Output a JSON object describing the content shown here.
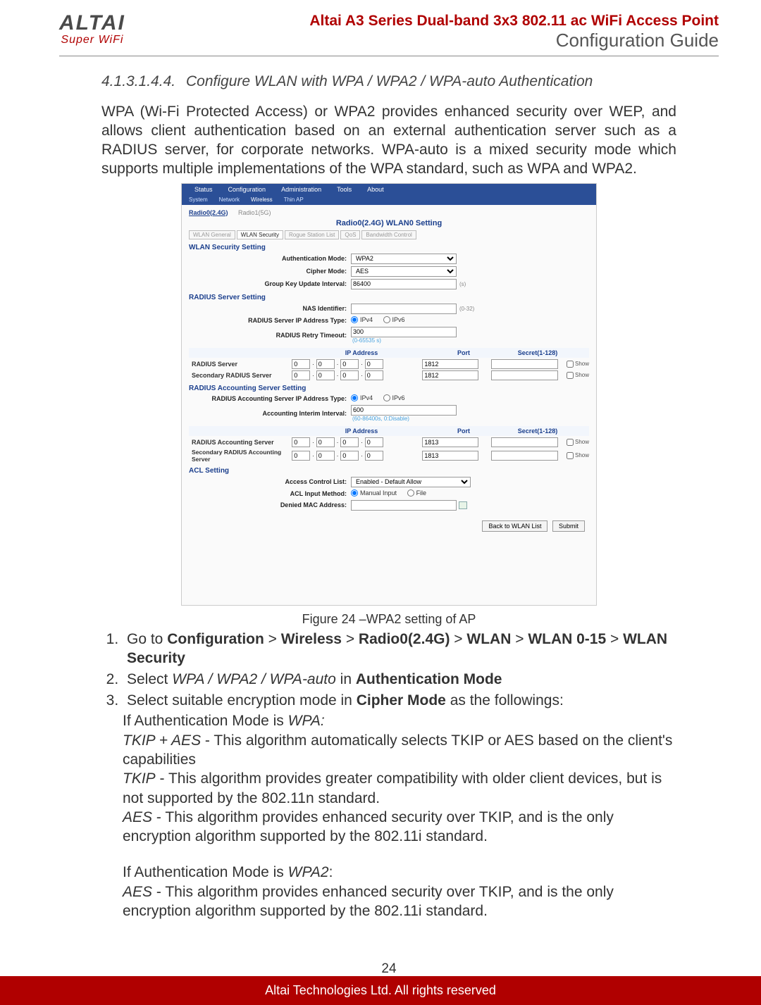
{
  "header": {
    "logo_top": "ALTAI",
    "logo_sub": "Super WiFi",
    "title1": "Altai A3 Series Dual-band 3x3 802.11 ac WiFi Access Point",
    "title2": "Configuration Guide"
  },
  "section": {
    "number": "4.1.3.1.4.4.",
    "title": "Configure WLAN with WPA / WPA2 / WPA-auto Authentication"
  },
  "intro": "WPA (Wi-Fi Protected Access) or WPA2 provides enhanced security over WEP, and allows client authentication based on an external authentication server such as a RADIUS server, for corporate networks. WPA-auto is a mixed security mode which supports multiple implementations of the WPA standard, such as WPA and WPA2.",
  "fig": {
    "topbar": [
      "Status",
      "Configuration",
      "Administration",
      "Tools",
      "About"
    ],
    "subbar": [
      "System",
      "Network",
      "Wireless",
      "Thin AP"
    ],
    "subbar_active": "Wireless",
    "radio_a": "Radio0(2.4G)",
    "radio_b": "Radio1(5G)",
    "panel_title": "Radio0(2.4G) WLAN0 Setting",
    "tabs": [
      "WLAN General",
      "WLAN Security",
      "Rogue Station List",
      "QoS",
      "Bandwidth Control"
    ],
    "tabs_active": "WLAN Security",
    "sec_wlan": "WLAN Security Setting",
    "lbl_auth": "Authentication Mode:",
    "val_auth": "WPA2",
    "lbl_cipher": "Cipher Mode:",
    "val_cipher": "AES",
    "lbl_gkui": "Group Key Update Interval:",
    "val_gkui": "86400",
    "gkui_hint": "(s)",
    "sec_radius": "RADIUS Server Setting",
    "lbl_nas": "NAS Identifier:",
    "nas_hint": "(0-32)",
    "lbl_rsat": "RADIUS Server IP Address Type:",
    "ipv4": "IPv4",
    "ipv6": "IPv6",
    "lbl_retry": "RADIUS Retry Timeout:",
    "val_retry": "300",
    "retry_hint": "(0-65535 s)",
    "th_ip": "IP Address",
    "th_port": "Port",
    "th_secret": "Secret(1-128)",
    "row_rs": "RADIUS Server",
    "row_srs": "Secondary RADIUS Server",
    "port_1812": "1812",
    "show": "Show",
    "sec_racct": "RADIUS Accounting Server Setting",
    "lbl_raat": "RADIUS Accounting Server IP Address Type:",
    "lbl_aii": "Accounting Interim Interval:",
    "val_aii": "600",
    "aii_hint": "(60-86400s, 0:Disable)",
    "row_ras": "RADIUS Accounting Server",
    "row_sras": "Secondary RADIUS Accounting Server",
    "port_1813": "1813",
    "sec_acl": "ACL Setting",
    "lbl_acl": "Access Control List:",
    "val_acl": "Enabled - Default Allow",
    "lbl_aim": "ACL Input Method:",
    "aim_manual": "Manual Input",
    "aim_file": "File",
    "lbl_dma": "Denied MAC Address:",
    "btn_back": "Back to WLAN List",
    "btn_submit": "Submit",
    "caption": "Figure 24 –WPA2 setting of AP",
    "ip_zero": "0"
  },
  "steps": {
    "s1a": "Go to ",
    "s1_conf": "Configuration",
    "gt": " > ",
    "s1_wireless": "Wireless",
    "s1_radio": "Radio0(2.4G)",
    "s1_wlan": "WLAN",
    "s1_wlan015": "WLAN 0-15",
    "s1_wlansec": "WLAN Security",
    "s2a": "Select ",
    "s2i": "WPA / WPA2 / WPA-auto",
    "s2b": " in ",
    "s2_am": "Authentication Mode",
    "s3a": "Select suitable encryption mode in ",
    "s3_cm": "Cipher Mode",
    "s3b": " as the followings:"
  },
  "para": {
    "p1a": "If Authentication Mode is ",
    "p1i": "WPA:",
    "p2i": "TKIP + AES",
    "p2b": " - This algorithm automatically selects TKIP or AES based on the client's capabilities",
    "p3i": "TKIP",
    "p3b": " - This algorithm provides greater compatibility with older client devices, but is not supported by the 802.11n standard.",
    "p4i": "AES",
    "p4b": " - This algorithm provides enhanced security over TKIP, and is the only encryption algorithm supported by the 802.11i standard.",
    "p5a": "If Authentication Mode is ",
    "p5i": "WPA2",
    "p5c": ":",
    "p6i": "AES",
    "p6b": " - This algorithm provides enhanced security over TKIP, and is the only encryption algorithm supported by the 802.11i standard."
  },
  "pagenum": "24",
  "footer": "Altai Technologies Ltd. All rights reserved"
}
